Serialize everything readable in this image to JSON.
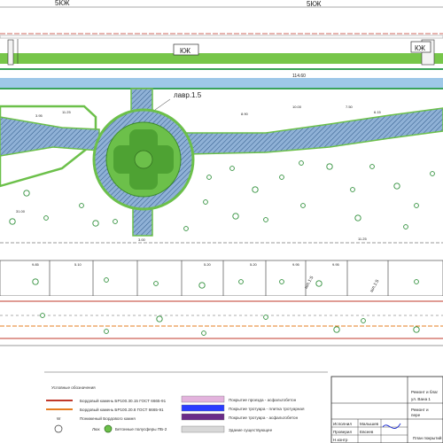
{
  "top_labels": {
    "left": "5КЖ",
    "right": "5КЖ"
  },
  "kzh_boxes": [
    "КЖ",
    "КЖ"
  ],
  "road_dim": "114.60",
  "ramp_label": "лавр.1.5",
  "dimensions": [
    "3.95",
    "11.25",
    "8.90",
    "10.00",
    "7.50",
    "6.15",
    "3.00",
    "31.00",
    "9.85",
    "5.10",
    "5.20",
    "9.95",
    "9.95",
    "5.20"
  ],
  "slope_labels": [
    "шл.1:5",
    "шл.1:5"
  ],
  "legend": {
    "title": "Условные обозначения",
    "left_items": [
      "Бордовый камень БР100.30.15 ГОСТ 6665-91",
      "Бордовый камень БР100.20.8 ГОСТ 6665-91",
      "Пониженый Бордового камня"
    ],
    "bottom_items": [
      "Люк",
      "Бетонные полусферы ПБ-2"
    ],
    "right_items": [
      "Покрытие проезда - асфальтобетон",
      "Покрытие тротуара - плитка тротуарная",
      "Покрытие тротуара - асфальтобетон",
      "Здание существующее"
    ],
    "colors": {
      "curb_red": "#c0392b",
      "curb_orange": "#e67e22",
      "asphalt_pink": "#e3b3dd",
      "tile_blue": "#2a3cff",
      "asphalt_purple": "#6a2c88",
      "building_grey": "#d8d8d8",
      "lawn_green": "#6cc04a",
      "walkway_blue": "#7fa0c8"
    }
  },
  "stamp": {
    "title_a": "Ремонт и благ",
    "title_b": "ул. Вана 1",
    "title_c": "Ремонт и",
    "title_d": "пере",
    "rows": [
      "Исполнил",
      "Проверил",
      "Н.контр"
    ],
    "names": [
      "Малышев",
      "Евсеев"
    ],
    "sheet_label": "План покрытий"
  }
}
